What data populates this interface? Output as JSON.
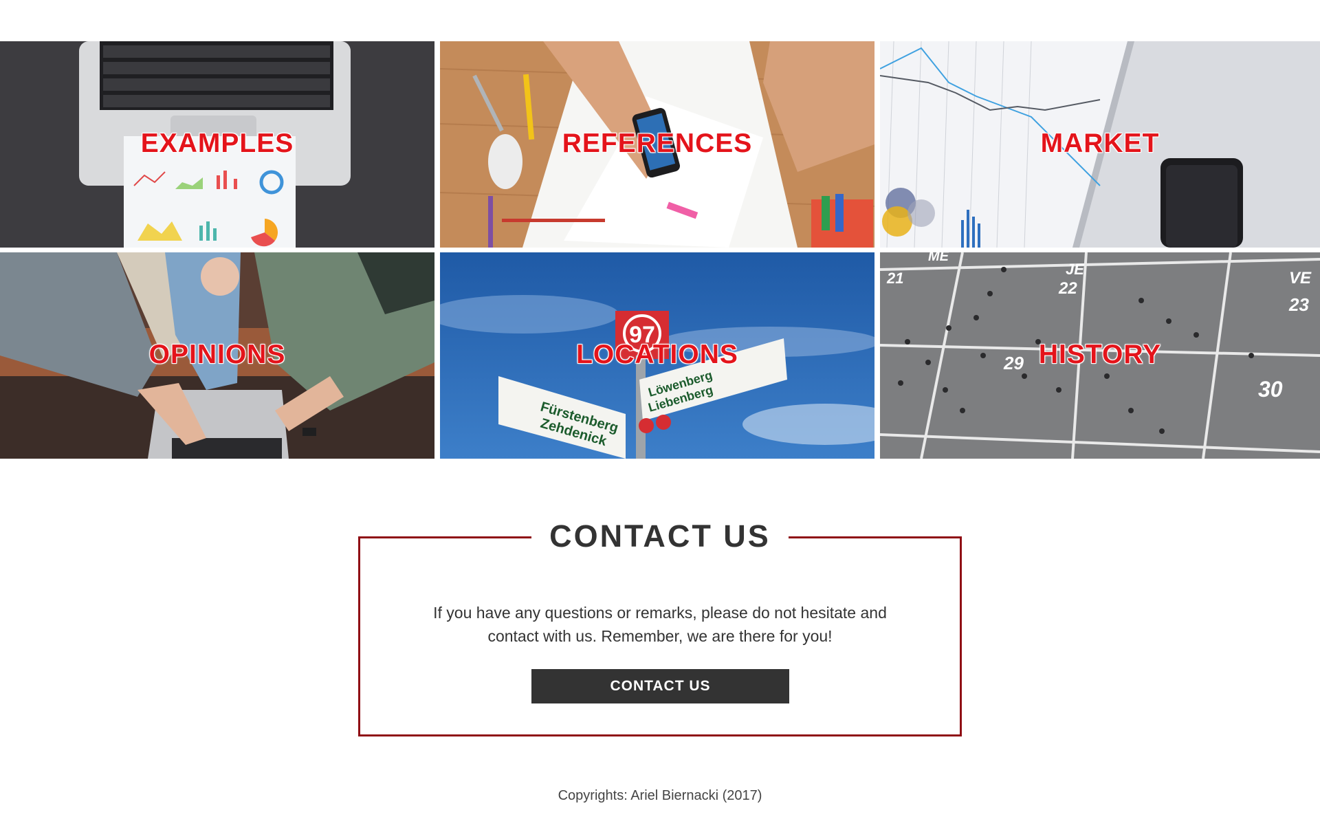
{
  "tiles": [
    {
      "label": "EXAMPLES",
      "image": "laptop-with-charts-photo"
    },
    {
      "label": "REFERENCES",
      "image": "desk-sketches-phone-photo"
    },
    {
      "label": "MARKET",
      "image": "market-line-chart-photo"
    },
    {
      "label": "OPINIONS",
      "image": "people-around-laptop-photo"
    },
    {
      "label": "LOCATIONS",
      "image": "street-signs-sky-photo"
    },
    {
      "label": "HISTORY",
      "image": "calendar-square-crowd-photo"
    }
  ],
  "contact": {
    "title": "CONTACT US",
    "text_line1": "If you have any questions or remarks, please do not hesitate and",
    "text_line2": "contact with us. Remember, we are there for you!",
    "button_label": "CONTACT US"
  },
  "footer": {
    "copyright": "Copyrights: Ariel Biernacki (2017)"
  },
  "colors": {
    "accent": "#e4141b",
    "border": "#8f0d14",
    "button": "#333333"
  }
}
